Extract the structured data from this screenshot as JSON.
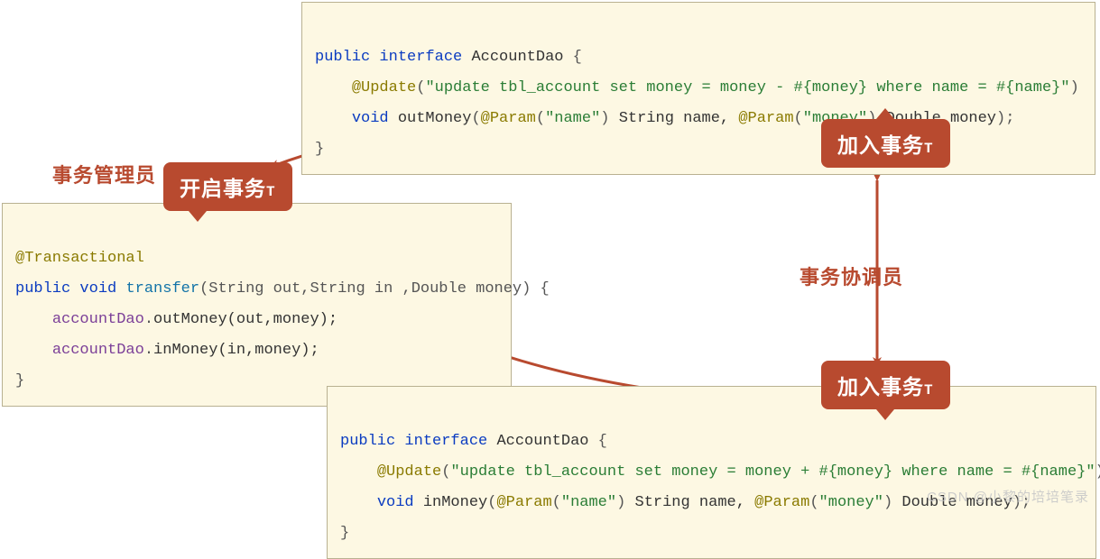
{
  "labels": {
    "manager": "事务管理员",
    "coordinator": "事务协调员"
  },
  "callouts": {
    "start": "开启事务",
    "join_top": "加入事务",
    "join_bottom": "加入事务",
    "t_suffix": "T"
  },
  "code_top": {
    "line1": {
      "kw_public": "public",
      "kw_interface": "interface",
      "class_name": "AccountDao",
      "brace": " {"
    },
    "line2": {
      "anno": "@Update",
      "open": "(",
      "str": "\"update tbl_account set money = money - #{money} where name = #{name}\"",
      "close": ")"
    },
    "line3": {
      "kw_void": "void",
      "method": "outMoney",
      "open": "(",
      "anno1": "@Param",
      "p1o": "(",
      "p1s": "\"name\"",
      "p1c": ")",
      "sp1": " String name, ",
      "anno2": "@Param",
      "p2o": "(",
      "p2s": "\"money\"",
      "p2c": ")",
      "sp2": " Double money",
      "close": ");"
    },
    "line4": "}"
  },
  "code_left": {
    "line1": {
      "anno": "@Transactional"
    },
    "line2": {
      "kw_public": "public",
      "kw_void": "void",
      "method": "transfer",
      "sig": "(String out,String in ,Double money) {"
    },
    "line3": {
      "indent": "    ",
      "obj": "accountDao",
      "dot": ".",
      "call": "outMoney(out,money);"
    },
    "line4": {
      "indent": "    ",
      "obj": "accountDao",
      "dot": ".",
      "call": "inMoney(in,money);"
    },
    "line5": "}"
  },
  "code_bottom": {
    "line1": {
      "kw_public": "public",
      "kw_interface": "interface",
      "class_name": "AccountDao",
      "brace": " {"
    },
    "line2": {
      "anno": "@Update",
      "open": "(",
      "str": "\"update tbl_account set money = money + #{money} where name = #{name}\"",
      "close": ")"
    },
    "line3": {
      "kw_void": "void",
      "method": "inMoney",
      "open": "(",
      "anno1": "@Param",
      "p1o": "(",
      "p1s": "\"name\"",
      "p1c": ")",
      "sp1": " String name, ",
      "anno2": "@Param",
      "p2o": "(",
      "p2s": "\"money\"",
      "p2c": ")",
      "sp2": " Double money",
      "close": ");"
    },
    "line4": "}"
  },
  "watermark": "CSDN @小黎的培培笔录"
}
